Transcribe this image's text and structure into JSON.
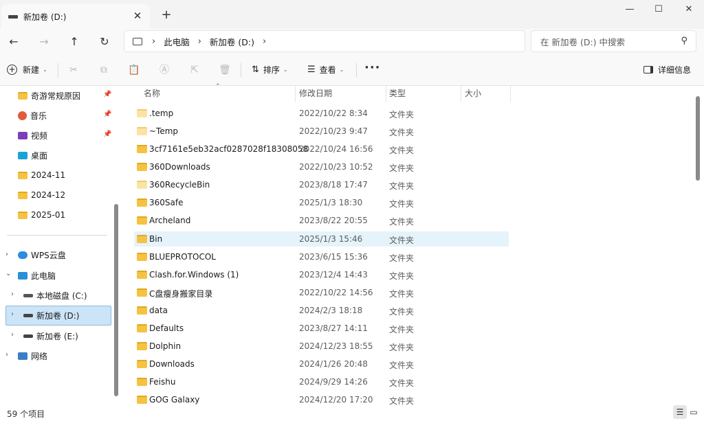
{
  "tab": {
    "title": "新加卷 (D:)",
    "close": "✕",
    "new_tab": "+"
  },
  "window": {
    "minimize": "—",
    "maximize": "☐",
    "close": "✕"
  },
  "nav": {
    "back": "←",
    "forward": "→",
    "up": "↑",
    "refresh": "↻",
    "sep": "›"
  },
  "address": {
    "crumbs": [
      "此电脑",
      "新加卷 (D:)"
    ]
  },
  "search": {
    "placeholder": "在 新加卷 (D:) 中搜索"
  },
  "toolbar": {
    "new_label": "新建",
    "sort_label": "排序",
    "view_label": "查看",
    "more": "···",
    "details_label": "详细信息"
  },
  "sidebar": {
    "quick": [
      {
        "label": "奇游常规原因",
        "icon": "folder-icon",
        "pinned": true
      },
      {
        "label": "音乐",
        "icon": "music-icon",
        "pinned": true
      },
      {
        "label": "视频",
        "icon": "video-icon",
        "pinned": true
      },
      {
        "label": "桌面",
        "icon": "desktop-icon",
        "pinned": false
      },
      {
        "label": "2024-11",
        "icon": "folder-icon",
        "pinned": false
      },
      {
        "label": "2024-12",
        "icon": "folder-icon",
        "pinned": false
      },
      {
        "label": "2025-01",
        "icon": "folder-icon",
        "pinned": false
      }
    ],
    "tree": [
      {
        "label": "WPS云盘",
        "icon": "cloud-icon",
        "expander": "›"
      },
      {
        "label": "此电脑",
        "icon": "pc-icon",
        "expander": "⌄"
      },
      {
        "label": "本地磁盘 (C:)",
        "icon": "drive-c-icon",
        "expander": "›"
      },
      {
        "label": "新加卷 (D:)",
        "icon": "drive-icon",
        "expander": "›"
      },
      {
        "label": "新加卷 (E:)",
        "icon": "drive-icon",
        "expander": "›"
      },
      {
        "label": "网络",
        "icon": "network-icon",
        "expander": "›"
      }
    ]
  },
  "columns": {
    "name": "名称",
    "modified": "修改日期",
    "type": "类型",
    "size": "大小"
  },
  "files": [
    {
      "name": ".temp",
      "date": "2022/10/22 8:34",
      "type": "文件夹"
    },
    {
      "name": "~Temp",
      "date": "2022/10/23 9:47",
      "type": "文件夹"
    },
    {
      "name": "3cf7161e5eb32acf0287028f18308058",
      "date": "2022/10/24 16:56",
      "type": "文件夹"
    },
    {
      "name": "360Downloads",
      "date": "2022/10/23 10:52",
      "type": "文件夹"
    },
    {
      "name": "360RecycleBin",
      "date": "2023/8/18 17:47",
      "type": "文件夹"
    },
    {
      "name": "360Safe",
      "date": "2025/1/3 18:30",
      "type": "文件夹"
    },
    {
      "name": "Archeland",
      "date": "2023/8/22 20:55",
      "type": "文件夹"
    },
    {
      "name": "Bin",
      "date": "2025/1/3 15:46",
      "type": "文件夹"
    },
    {
      "name": "BLUEPROTOCOL",
      "date": "2023/6/15 15:36",
      "type": "文件夹"
    },
    {
      "name": "Clash.for.Windows (1)",
      "date": "2023/12/4 14:43",
      "type": "文件夹"
    },
    {
      "name": "C盘瘦身搬家目录",
      "date": "2022/10/22 14:56",
      "type": "文件夹"
    },
    {
      "name": "data",
      "date": "2024/2/3 18:18",
      "type": "文件夹"
    },
    {
      "name": "Defaults",
      "date": "2023/8/27 14:11",
      "type": "文件夹"
    },
    {
      "name": "Dolphin",
      "date": "2024/12/23 18:55",
      "type": "文件夹"
    },
    {
      "name": "Downloads",
      "date": "2024/1/26 20:48",
      "type": "文件夹"
    },
    {
      "name": "Feishu",
      "date": "2024/9/29 14:26",
      "type": "文件夹"
    },
    {
      "name": "GOG Galaxy",
      "date": "2024/12/20 17:20",
      "type": "文件夹"
    }
  ],
  "status": {
    "count": "59 个项目"
  },
  "colors": {
    "selected_bg": "#cce4f7",
    "hover_bg": "#e5f3fb",
    "folder": "#f5c242"
  }
}
